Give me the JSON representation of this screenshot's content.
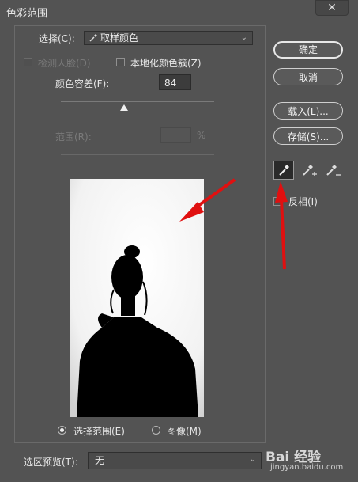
{
  "window": {
    "title": "色彩范围",
    "close_label": "✕"
  },
  "select": {
    "label": "选择(C):",
    "value": "取样颜色"
  },
  "detect_faces": {
    "label": "检测人脸(D)",
    "checked": false,
    "enabled": false
  },
  "localized_clusters": {
    "label": "本地化颜色簇(Z)",
    "checked": false
  },
  "fuzziness": {
    "label": "颜色容差(F):",
    "value": "84",
    "slider_fraction": 0.41
  },
  "range": {
    "label": "范围(R):",
    "value": "",
    "unit": "%",
    "enabled": false
  },
  "buttons": {
    "ok": "确定",
    "cancel": "取消",
    "load": "载入(L)...",
    "save": "存储(S)..."
  },
  "tools": [
    "eyedropper-icon",
    "eyedropper-add-icon",
    "eyedropper-subtract-icon"
  ],
  "invert": {
    "label": "反相(I)",
    "checked": false
  },
  "view_mode": {
    "options": [
      {
        "label": "选择范围(E)",
        "selected": true
      },
      {
        "label": "图像(M)",
        "selected": false
      }
    ]
  },
  "selection_preview": {
    "label": "选区预览(T):",
    "value": "无"
  },
  "watermark": {
    "brand": "Bai 经验",
    "url": "jingyan.baidu.com"
  },
  "colors": {
    "background": "#535353",
    "annotation_arrow": "#e01010"
  }
}
